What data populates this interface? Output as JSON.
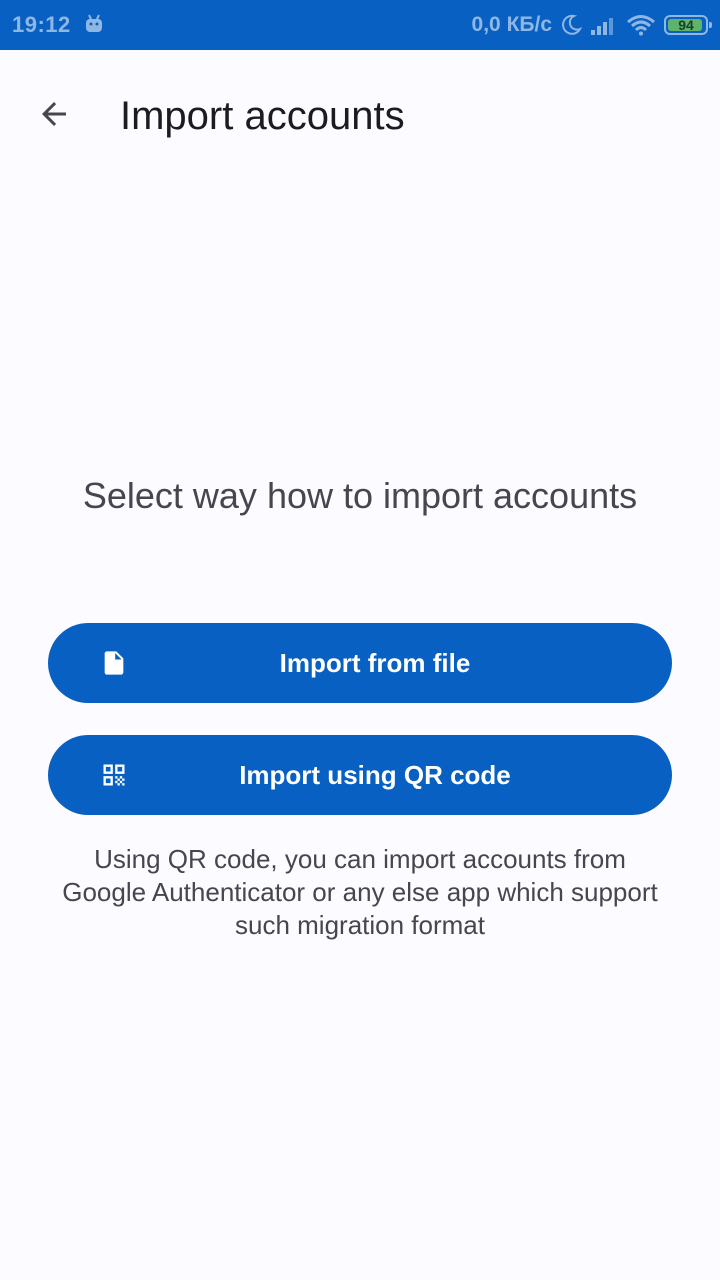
{
  "status_bar": {
    "time": "19:12",
    "network_speed": "0,0 КБ/с",
    "battery_level": "94",
    "battery_fraction": 0.94
  },
  "app_bar": {
    "title": "Import accounts",
    "back_icon": "arrow-back-icon"
  },
  "content": {
    "heading": "Select way how to import accounts",
    "import_file_label": "Import from file",
    "import_file_icon": "file-icon",
    "import_qr_label": "Import using QR code",
    "import_qr_icon": "qr-code-icon",
    "hint": "Using QR code, you can import accounts from Google Authenticator or any else app which support such migration format"
  },
  "colors": {
    "primary": "#0860C2",
    "background": "#FCFBFF",
    "text_primary": "#1C1B1F",
    "text_secondary": "#46464F"
  }
}
